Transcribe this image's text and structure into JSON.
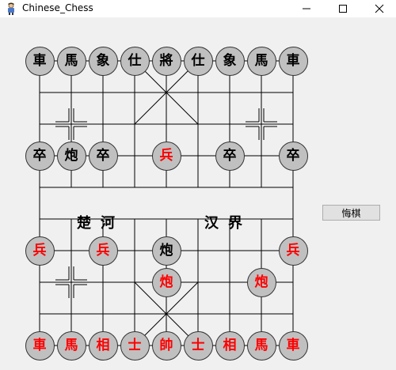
{
  "window": {
    "title": "Chinese_Chess"
  },
  "board": {
    "river_left": "楚河",
    "river_right": "汉界",
    "line_color": "#000000",
    "background": "#f0f0f0"
  },
  "colors": {
    "black_piece_text": "#000000",
    "red_piece_text": "#ff0000",
    "piece_fill": "#c0c0c0"
  },
  "pieces": [
    {
      "name": "black-chariot-left",
      "char": "車",
      "side": "black",
      "col": 0,
      "row": 0
    },
    {
      "name": "black-horse-left",
      "char": "馬",
      "side": "black",
      "col": 1,
      "row": 0
    },
    {
      "name": "black-elephant-left",
      "char": "象",
      "side": "black",
      "col": 2,
      "row": 0
    },
    {
      "name": "black-advisor-left",
      "char": "仕",
      "side": "black",
      "col": 3,
      "row": 0
    },
    {
      "name": "black-general",
      "char": "將",
      "side": "black",
      "col": 4,
      "row": 0
    },
    {
      "name": "black-advisor-right",
      "char": "仕",
      "side": "black",
      "col": 5,
      "row": 0
    },
    {
      "name": "black-elephant-right",
      "char": "象",
      "side": "black",
      "col": 6,
      "row": 0
    },
    {
      "name": "black-horse-right",
      "char": "馬",
      "side": "black",
      "col": 7,
      "row": 0
    },
    {
      "name": "black-chariot-right",
      "char": "車",
      "side": "black",
      "col": 8,
      "row": 0
    },
    {
      "name": "black-soldier-1",
      "char": "卒",
      "side": "black",
      "col": 0,
      "row": 3
    },
    {
      "name": "black-cannon-left",
      "char": "炮",
      "side": "black",
      "col": 1,
      "row": 3
    },
    {
      "name": "black-soldier-2",
      "char": "卒",
      "side": "black",
      "col": 2,
      "row": 3
    },
    {
      "name": "red-soldier-advanced",
      "char": "兵",
      "side": "red",
      "col": 4,
      "row": 3
    },
    {
      "name": "black-soldier-4",
      "char": "卒",
      "side": "black",
      "col": 6,
      "row": 3
    },
    {
      "name": "black-soldier-5",
      "char": "卒",
      "side": "black",
      "col": 8,
      "row": 3
    },
    {
      "name": "red-soldier-1",
      "char": "兵",
      "side": "red",
      "col": 0,
      "row": 6
    },
    {
      "name": "red-soldier-2",
      "char": "兵",
      "side": "red",
      "col": 2,
      "row": 6
    },
    {
      "name": "black-cannon-right",
      "char": "炮",
      "side": "black",
      "col": 4,
      "row": 6
    },
    {
      "name": "red-soldier-5",
      "char": "兵",
      "side": "red",
      "col": 8,
      "row": 6
    },
    {
      "name": "red-cannon-left",
      "char": "炮",
      "side": "red",
      "col": 4,
      "row": 7
    },
    {
      "name": "red-cannon-right",
      "char": "炮",
      "side": "red",
      "col": 7,
      "row": 7
    },
    {
      "name": "red-chariot-left",
      "char": "車",
      "side": "red",
      "col": 0,
      "row": 9
    },
    {
      "name": "red-horse-left",
      "char": "馬",
      "side": "red",
      "col": 1,
      "row": 9
    },
    {
      "name": "red-elephant-left",
      "char": "相",
      "side": "red",
      "col": 2,
      "row": 9
    },
    {
      "name": "red-advisor-left",
      "char": "士",
      "side": "red",
      "col": 3,
      "row": 9
    },
    {
      "name": "red-general",
      "char": "帥",
      "side": "red",
      "col": 4,
      "row": 9
    },
    {
      "name": "red-advisor-right",
      "char": "士",
      "side": "red",
      "col": 5,
      "row": 9
    },
    {
      "name": "red-elephant-right",
      "char": "相",
      "side": "red",
      "col": 6,
      "row": 9
    },
    {
      "name": "red-horse-right",
      "char": "馬",
      "side": "red",
      "col": 7,
      "row": 9
    },
    {
      "name": "red-chariot-right",
      "char": "車",
      "side": "red",
      "col": 8,
      "row": 9
    }
  ],
  "controls": {
    "undo_label": "悔棋"
  }
}
